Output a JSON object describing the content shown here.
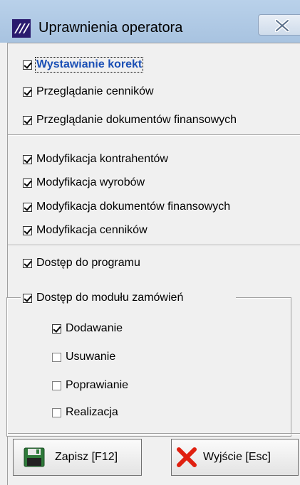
{
  "window": {
    "title": "Uprawnienia operatora"
  },
  "section1": {
    "items": [
      {
        "label": "Wystawianie korekt",
        "checked": true,
        "focused": true
      },
      {
        "label": "Przeglądanie cenników",
        "checked": true
      },
      {
        "label": "Przeglądanie dokumentów finansowych",
        "checked": true
      }
    ]
  },
  "section2": {
    "items": [
      {
        "label": "Modyfikacja kontrahentów",
        "checked": true
      },
      {
        "label": "Modyfikacja wyrobów",
        "checked": true
      },
      {
        "label": "Modyfikacja dokumentów finansowych",
        "checked": true
      },
      {
        "label": "Modyfikacja cenników",
        "checked": true
      }
    ]
  },
  "section3": {
    "access": {
      "label": "Dostęp do programu",
      "checked": true
    },
    "orders": {
      "label": "Dostęp do modułu zamówień",
      "checked": true,
      "items": [
        {
          "label": "Dodawanie",
          "checked": true
        },
        {
          "label": "Usuwanie",
          "checked": false
        },
        {
          "label": "Poprawianie",
          "checked": false
        },
        {
          "label": "Realizacja",
          "checked": false
        }
      ]
    }
  },
  "buttons": {
    "save_label": "Zapisz  [F12]",
    "exit_label": "Wyjście  [Esc]"
  },
  "icons": {
    "app": "app-logo-icon",
    "close": "close-icon",
    "save": "floppy-disk-icon",
    "exit": "red-x-icon"
  },
  "colors": {
    "titlebar": "#b9d1ea",
    "focused_text": "#1a4fb5",
    "exit_x": "#e02010",
    "floppy": "#2f7a3a"
  }
}
